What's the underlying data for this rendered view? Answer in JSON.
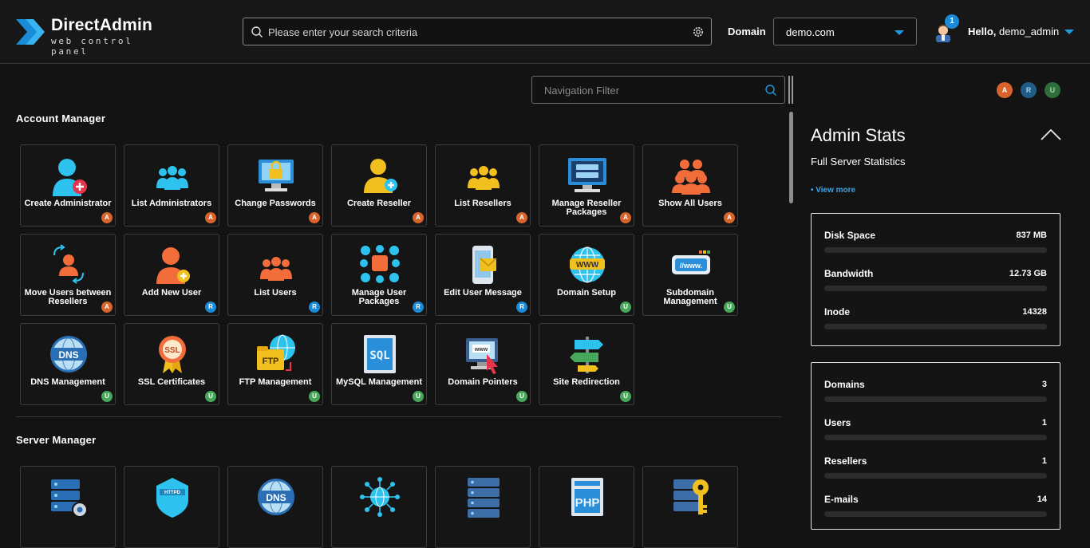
{
  "app": {
    "logo_name": "DirectAdmin",
    "logo_sub": "web control panel"
  },
  "header": {
    "search_placeholder": "Please enter your search criteria",
    "domain_label": "Domain",
    "domain_value": "demo.com",
    "notifications": "1",
    "hello": "Hello,",
    "username": "demo_admin"
  },
  "nav_filter": {
    "placeholder": "Navigation Filter"
  },
  "roles": [
    "A",
    "R",
    "U"
  ],
  "role_colors": {
    "A": "#d8642c",
    "R": "#1a8bd8",
    "U": "#47a85b"
  },
  "sections": [
    {
      "title": "Account Manager",
      "tiles": [
        {
          "label": "Create Administrator",
          "icon": "create-admin-icon",
          "role": "A"
        },
        {
          "label": "List Administrators",
          "icon": "list-admins-icon",
          "role": "A"
        },
        {
          "label": "Change Passwords",
          "icon": "change-passwords-icon",
          "role": "A"
        },
        {
          "label": "Create Reseller",
          "icon": "create-reseller-icon",
          "role": "A"
        },
        {
          "label": "List Resellers",
          "icon": "list-resellers-icon",
          "role": "A"
        },
        {
          "label": "Manage Reseller Packages",
          "icon": "reseller-packages-icon",
          "role": "A"
        },
        {
          "label": "Show All Users",
          "icon": "all-users-icon",
          "role": "A"
        },
        {
          "label": "Move Users between Resellers",
          "icon": "move-users-icon",
          "role": "A"
        },
        {
          "label": "Add New User",
          "icon": "add-user-icon",
          "role": "R"
        },
        {
          "label": "List Users",
          "icon": "list-users-icon",
          "role": "R"
        },
        {
          "label": "Manage User Packages",
          "icon": "user-packages-icon",
          "role": "R"
        },
        {
          "label": "Edit User Message",
          "icon": "user-message-icon",
          "role": "R"
        },
        {
          "label": "Domain Setup",
          "icon": "domain-setup-icon",
          "role": "U"
        },
        {
          "label": "Subdomain Management",
          "icon": "subdomain-icon",
          "role": "U"
        },
        {
          "label": "DNS Management",
          "icon": "dns-icon",
          "role": "U"
        },
        {
          "label": "SSL Certificates",
          "icon": "ssl-icon",
          "role": "U"
        },
        {
          "label": "FTP Management",
          "icon": "ftp-icon",
          "role": "U"
        },
        {
          "label": "MySQL Management",
          "icon": "mysql-icon",
          "role": "U"
        },
        {
          "label": "Domain Pointers",
          "icon": "domain-pointers-icon",
          "role": "U"
        },
        {
          "label": "Site Redirection",
          "icon": "site-redirection-icon",
          "role": "U"
        }
      ]
    },
    {
      "title": "Server Manager",
      "tiles": [
        {
          "label": "",
          "icon": "server-settings-icon",
          "role": ""
        },
        {
          "label": "",
          "icon": "httpd-icon",
          "role": ""
        },
        {
          "label": "",
          "icon": "dns-icon",
          "role": ""
        },
        {
          "label": "",
          "icon": "ip-network-icon",
          "role": ""
        },
        {
          "label": "",
          "icon": "multi-server-icon",
          "role": ""
        },
        {
          "label": "",
          "icon": "php-icon",
          "role": ""
        },
        {
          "label": "",
          "icon": "ssh-keys-icon",
          "role": ""
        }
      ]
    }
  ],
  "admin_stats": {
    "title": "Admin Stats",
    "subtitle": "Full Server Statistics",
    "view_more": "• View more",
    "usage": [
      {
        "label": "Disk Space",
        "value": "837 MB"
      },
      {
        "label": "Bandwidth",
        "value": "12.73 GB"
      },
      {
        "label": "Inode",
        "value": "14328"
      }
    ],
    "counts": [
      {
        "label": "Domains",
        "value": "3"
      },
      {
        "label": "Users",
        "value": "1"
      },
      {
        "label": "Resellers",
        "value": "1"
      },
      {
        "label": "E-mails",
        "value": "14"
      }
    ]
  }
}
